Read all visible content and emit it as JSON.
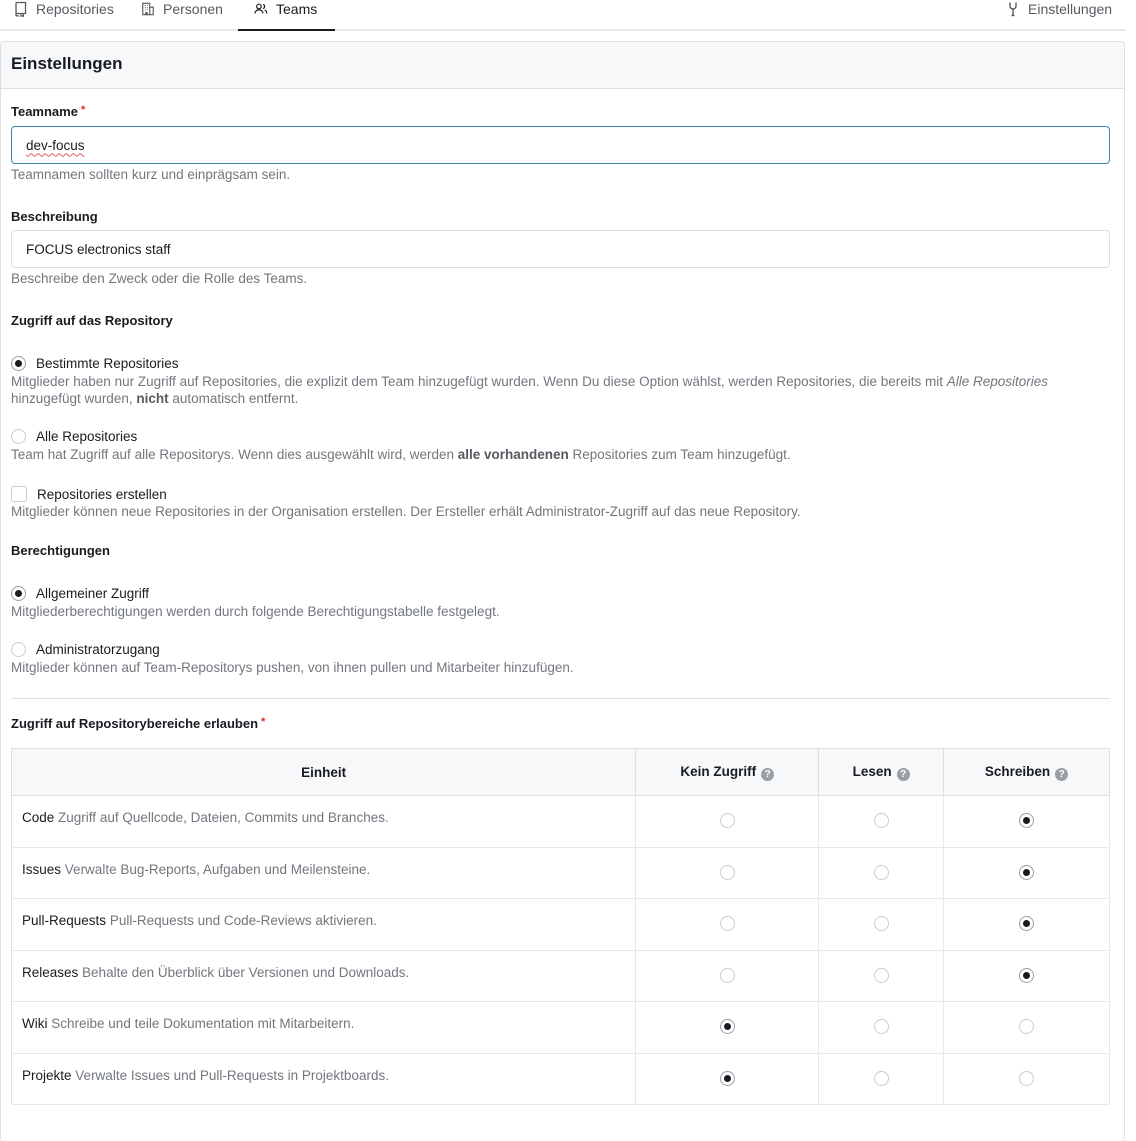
{
  "tabs": [
    {
      "label": "Repositories",
      "icon": "repo-icon"
    },
    {
      "label": "Personen",
      "icon": "building-icon"
    },
    {
      "label": "Teams",
      "icon": "people-icon",
      "active": true
    }
  ],
  "settings_tab": {
    "label": "Einstellungen",
    "icon": "tool-icon"
  },
  "panel": {
    "title": "Einstellungen"
  },
  "teamname": {
    "label": "Teamname",
    "required_mark": "*",
    "value": "dev-focus",
    "help": "Teamnamen sollten kurz und einprägsam sein."
  },
  "description": {
    "label": "Beschreibung",
    "value": "FOCUS electronics staff",
    "help": "Beschreibe den Zweck oder die Rolle des Teams."
  },
  "repo_access": {
    "label": "Zugriff auf das Repository",
    "specific": {
      "label": "Bestimmte Repositories",
      "help_1": "Mitglieder haben nur Zugriff auf Repositories, die explizit dem Team hinzugefügt wurden. Wenn Du diese Option wählst, werden Repositories, die bereits mit ",
      "help_em": "Alle Repositories",
      "help_2": "hinzugefügt wurden, ",
      "help_bold": "nicht",
      "help_3": " automatisch entfernt.",
      "selected": true
    },
    "all": {
      "label": "Alle Repositories",
      "help_1": "Team hat Zugriff auf alle Repositorys. Wenn dies ausgewählt wird, werden ",
      "help_bold": "alle vorhandenen",
      "help_2": " Repositories zum Team hinzugefügt.",
      "selected": false
    },
    "create": {
      "label": "Repositories erstellen",
      "help": "Mitglieder können neue Repositories in der Organisation erstellen. Der Ersteller erhält Administrator-Zugriff auf das neue Repository.",
      "checked": false
    }
  },
  "permissions": {
    "label": "Berechtigungen",
    "general": {
      "label": "Allgemeiner Zugriff",
      "help": "Mitgliederberechtigungen werden durch folgende Berechtigungstabelle festgelegt.",
      "selected": true
    },
    "admin": {
      "label": "Administratorzugang",
      "help": "Mitglieder können auf Team-Repositorys pushen, von ihnen pullen und Mitarbeiter hinzufügen.",
      "selected": false
    }
  },
  "units": {
    "label": "Zugriff auf Repositorybereiche erlauben",
    "required_mark": "*",
    "headers": {
      "unit": "Einheit",
      "none": "Kein Zugriff",
      "read": "Lesen",
      "write": "Schreiben"
    },
    "rows": [
      {
        "name": "Code",
        "desc": "Zugriff auf Quellcode, Dateien, Commits und Branches.",
        "access": "write"
      },
      {
        "name": "Issues",
        "desc": "Verwalte Bug-Reports, Aufgaben und Meilensteine.",
        "access": "write"
      },
      {
        "name": "Pull-Requests",
        "desc": "Pull-Requests und Code-Reviews aktivieren.",
        "access": "write"
      },
      {
        "name": "Releases",
        "desc": "Behalte den Überblick über Versionen und Downloads.",
        "access": "write"
      },
      {
        "name": "Wiki",
        "desc": "Schreibe und teile Dokumentation mit Mitarbeitern.",
        "access": "none"
      },
      {
        "name": "Projekte",
        "desc": "Verwalte Issues und Pull-Requests in Projektboards.",
        "access": "none"
      }
    ]
  }
}
